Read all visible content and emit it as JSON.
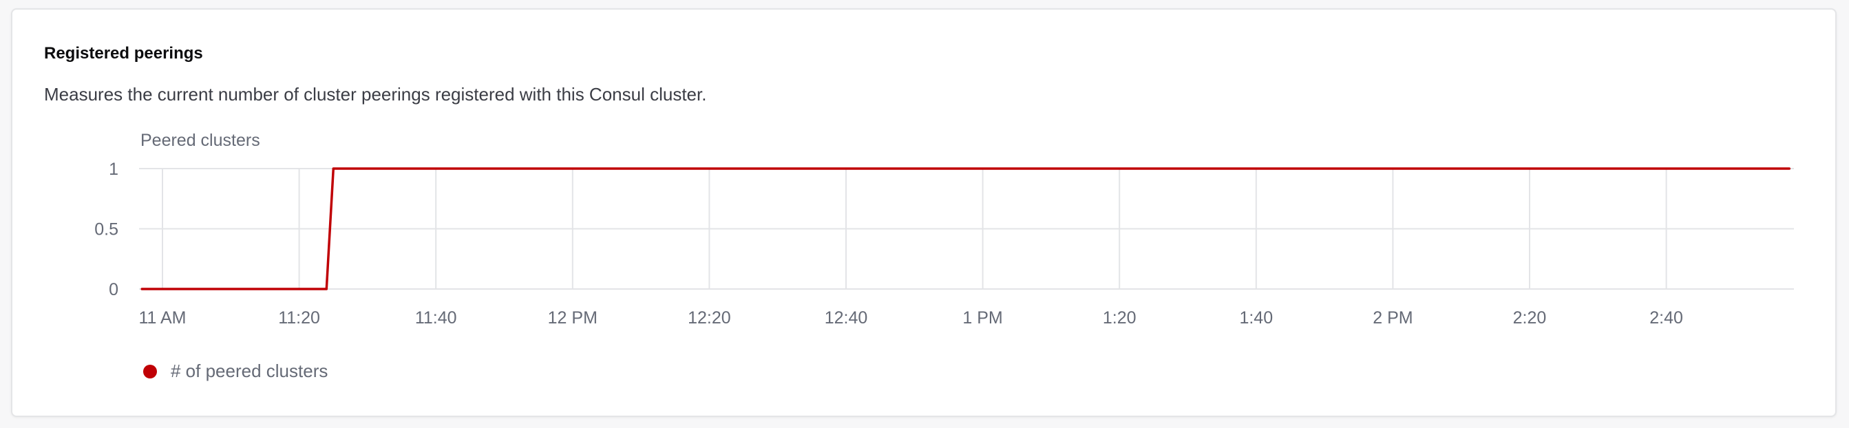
{
  "card": {
    "title": "Registered peerings",
    "description": "Measures the current number of cluster peerings registered with this Consul cluster."
  },
  "colors": {
    "series": "#c00005",
    "grid": "#e3e4e7",
    "axis_text": "#656a76"
  },
  "chart_data": {
    "type": "line",
    "ylabel": "Peered clusters",
    "xlabel": "",
    "xlim": [
      "10:58",
      "14:58"
    ],
    "ylim": [
      0,
      1
    ],
    "y_ticks": [
      {
        "value": 1,
        "label": "1"
      },
      {
        "value": 0.5,
        "label": "0.5"
      },
      {
        "value": 0,
        "label": "0"
      }
    ],
    "x_ticks": [
      {
        "value": "11:00",
        "label": "11 AM"
      },
      {
        "value": "11:20",
        "label": "11:20"
      },
      {
        "value": "11:40",
        "label": "11:40"
      },
      {
        "value": "12:00",
        "label": "12 PM"
      },
      {
        "value": "12:20",
        "label": "12:20"
      },
      {
        "value": "12:40",
        "label": "12:40"
      },
      {
        "value": "13:00",
        "label": "1 PM"
      },
      {
        "value": "13:20",
        "label": "1:20"
      },
      {
        "value": "13:40",
        "label": "1:40"
      },
      {
        "value": "14:00",
        "label": "2 PM"
      },
      {
        "value": "14:20",
        "label": "2:20"
      },
      {
        "value": "14:40",
        "label": "2:40"
      }
    ],
    "grid": true,
    "legend": "bottom-left",
    "series": [
      {
        "name": "# of peered clusters",
        "points": [
          {
            "x": "10:57",
            "y": 0
          },
          {
            "x": "11:24",
            "y": 0
          },
          {
            "x": "11:25",
            "y": 1
          },
          {
            "x": "14:58",
            "y": 1
          }
        ]
      }
    ]
  }
}
